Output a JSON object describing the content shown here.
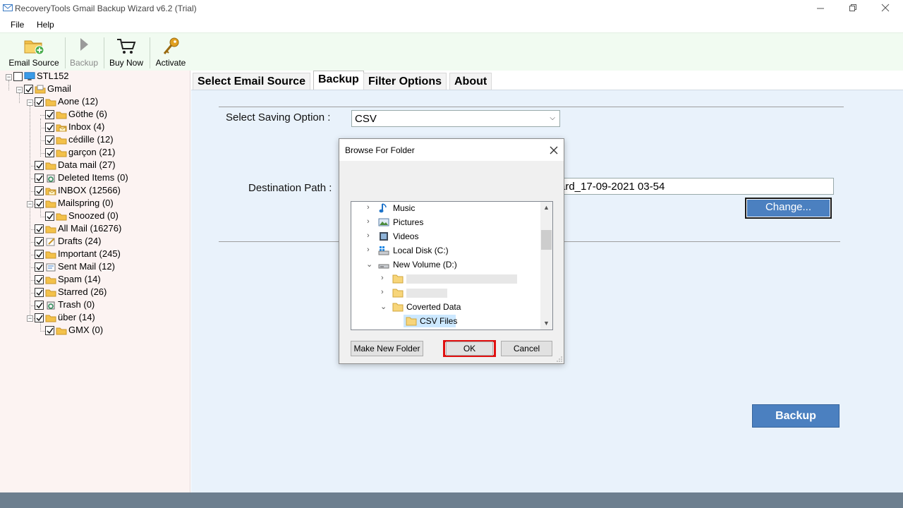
{
  "window": {
    "title": "RecoveryTools Gmail Backup Wizard v6.2 (Trial)",
    "minimize_icon": "minimize-icon",
    "restore_icon": "restore-icon",
    "close_icon": "close-icon"
  },
  "menu": {
    "file": "File",
    "help": "Help"
  },
  "toolbar": {
    "email_source": "Email Source",
    "backup": "Backup",
    "buy_now": "Buy Now",
    "activate": "Activate"
  },
  "tree": {
    "root": "STL152",
    "account": "Gmail",
    "items": [
      "Aone (12)",
      "Göthe (6)",
      "Inbox (4)",
      "cédille (12)",
      "garçon (21)",
      "Data mail (27)",
      "Deleted Items (0)",
      "INBOX (12566)",
      "Mailspring (0)",
      "Snoozed (0)",
      "All Mail (16276)",
      "Drafts (24)",
      "Important (245)",
      "Sent Mail (12)",
      "Spam (14)",
      "Starred (26)",
      "Trash (0)",
      "über (14)",
      "GMX (0)"
    ]
  },
  "tabs": {
    "select_source": "Select Email Source",
    "backup": "Backup",
    "filter": "Filter Options",
    "about": "About"
  },
  "backup_panel": {
    "saving_label": "Select Saving Option :",
    "saving_value": "CSV",
    "destination_label": "Destination Path :",
    "destination_value": "ard_17-09-2021 03-54",
    "change_button": "Change...",
    "backup_button": "Backup"
  },
  "dialog": {
    "title": "Browse For Folder",
    "nodes": {
      "music": "Music",
      "pictures": "Pictures",
      "videos": "Videos",
      "local_disk": "Local Disk (C:)",
      "new_volume": "New Volume (D:)",
      "hidden_1": "",
      "hidden_2": "",
      "coverted": "Coverted Data",
      "csv_files": "CSV Files"
    },
    "make_new_folder": "Make New Folder",
    "ok": "OK",
    "cancel": "Cancel"
  },
  "colors": {
    "accent": "#4b80c0",
    "highlight_frame": "#e01010",
    "selected_node": "#cce8ff",
    "panel_bg": "#e9f2fb",
    "tree_bg": "#fcf3f2",
    "toolbar_bg": "#f1fbf1"
  }
}
